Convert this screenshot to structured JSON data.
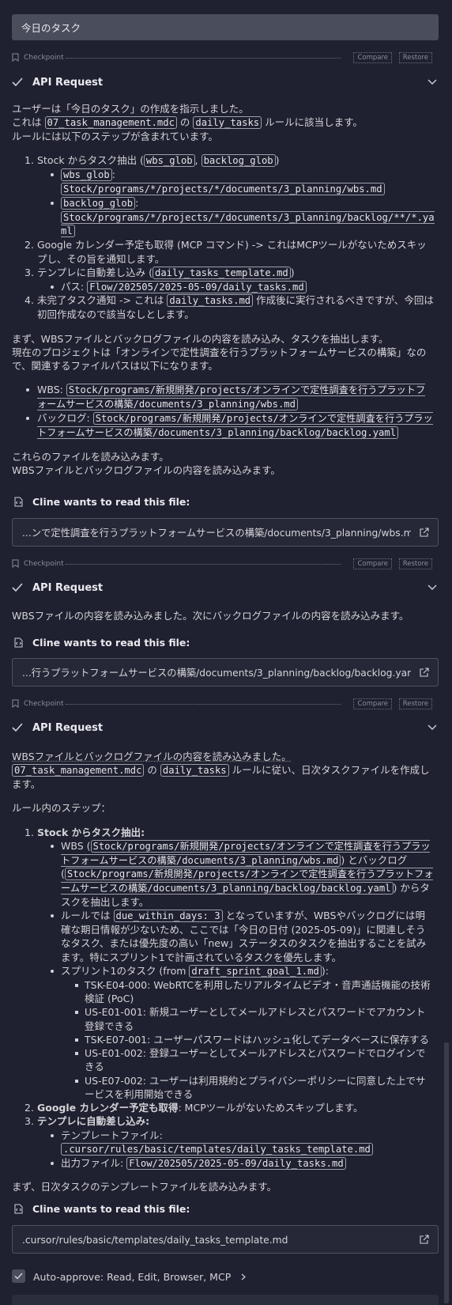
{
  "task_title": "今日のタスク",
  "checkpoint": {
    "label": "Checkpoint",
    "compare": "Compare",
    "restore": "Restore"
  },
  "api_request_label": "API Request",
  "read_file_label": "Cline wants to read this file:",
  "block1": {
    "intro1": "ユーザーは「今日のタスク」の作成を指示しました。",
    "intro2a": "これは",
    "intro2_code1": "07_task_management.mdc",
    "intro2b": "の",
    "intro2_code2": "daily_tasks",
    "intro2c": "ルールに該当します。",
    "intro3": "ルールには以下のステップが含まれています。",
    "step1_text": "Stock からタスク抽出 (",
    "step1_code1": "wbs_glob",
    "step1_comma": ",",
    "step1_code2": "backlog_glob",
    "step1_close": ")",
    "step1_sub1_code": "wbs_glob",
    "step1_sub1_path": "Stock/programs/*/projects/*/documents/3_planning/wbs.md",
    "step1_sub2_code": "backlog_glob",
    "step1_sub2_path": "Stock/programs/*/projects/*/documents/3_planning/backlog/**/*.yaml",
    "step2": "Google カレンダー予定も取得 (MCP コマンド) -> これはMCPツールがないためスキップし、その旨を通知します。",
    "step3_text": "テンプレに自動差し込み (",
    "step3_code": "daily_tasks_template.md",
    "step3_close": ")",
    "step3_sub_label": "パス:",
    "step3_sub_code": "Flow/202505/2025-05-09/daily_tasks.md",
    "step4_a": "未完了タスク通知 -> これは",
    "step4_code": "daily_tasks.md",
    "step4_b": "作成後に実行されるべきですが、今回は初回作成なので該当なしとします。",
    "para2_1": "まず、WBSファイルとバックログファイルの内容を読み込み、タスクを抽出します。",
    "para2_2": "現在のプロジェクトは「オンラインで定性調査を行うプラットフォームサービスの構築」なので、関連するファイルパスは以下になります。",
    "wbs_label": "WBS:",
    "wbs_path": "Stock/programs/新規開発/projects/オンラインで定性調査を行うプラットフォームサービスの構築/documents/3_planning/wbs.md",
    "backlog_label": "バックログ:",
    "backlog_path": "Stock/programs/新規開発/projects/オンラインで定性調査を行うプラットフォームサービスの構築/documents/3_planning/backlog/backlog.yaml",
    "end1": "これらのファイルを読み込みます。",
    "end2": "WBSファイルとバックログファイルの内容を読み込みます。",
    "file": "...ンで定性調査を行うプラットフォームサービスの構築/documents/3_planning/wbs.md"
  },
  "block2": {
    "text": "WBSファイルの内容を読み込みました。次にバックログファイルの内容を読み込みます。",
    "file": "...行うプラットフォームサービスの構築/documents/3_planning/backlog/backlog.yaml"
  },
  "block3": {
    "intro1": "WBSファイルとバックログファイルの内容を読み込みました。",
    "intro2_code1": "07_task_management.mdc",
    "intro2a": "の",
    "intro2_code2": "daily_tasks",
    "intro2b": "ルールに従い、日次タスクファイルを作成します。",
    "rules_steps": "ルール内のステップ：",
    "s1_title": "Stock からタスク抽出:",
    "s1_wbs_a": "WBS (",
    "s1_wbs_path": "Stock/programs/新規開発/projects/オンラインで定性調査を行うプラットフォームサービスの構築/documents/3_planning/wbs.md",
    "s1_wbs_b": ") とバックログ (",
    "s1_backlog_path": "Stock/programs/新規開発/projects/オンラインで定性調査を行うプラットフォームサービスの構築/documents/3_planning/backlog/backlog.yaml",
    "s1_wbs_c": ") からタスクを抽出します。",
    "s1_rule_a": "ルールでは",
    "s1_rule_code": "due_within_days: 3",
    "s1_rule_b": "となっていますが、WBSやバックログには明確な期日情報が少ないため、ここでは「今日の日付 (2025-05-09)」に関連しそうなタスク、または優先度の高い「new」ステータスのタスクを抽出することを試みます。特にスプリント1で計画されているタスクを優先します。",
    "s1_sprint_a": "スプリント1のタスク (from",
    "s1_sprint_code": "draft_sprint_goal_1.md",
    "s1_sprint_b": "):",
    "tasks": [
      "TSK-E04-000: WebRTCを利用したリアルタイムビデオ・音声通話機能の技術検証 (PoC)",
      "US-E01-001: 新規ユーザーとしてメールアドレスとパスワードでアカウント登録できる",
      "TSK-E07-001: ユーザーパスワードはハッシュ化してデータベースに保存する",
      "US-E01-002: 登録ユーザーとしてメールアドレスとパスワードでログインできる",
      "US-E07-002: ユーザーは利用規約とプライバシーポリシーに同意した上でサービスを利用開始できる"
    ],
    "s2_title": "Google カレンダー予定も取得",
    "s2_text": ": MCPツールがないためスキップします。",
    "s3_title": "テンプレに自動差し込み:",
    "s3_tpl_label": "テンプレートファイル:",
    "s3_tpl_code": ".cursor/rules/basic/templates/daily_tasks_template.md",
    "s3_out_label": "出力ファイル:",
    "s3_out_code": "Flow/202505/2025-05-09/daily_tasks.md",
    "end": "まず、日次タスクのテンプレートファイルを読み込みます。",
    "file": ".cursor/rules/basic/templates/daily_tasks_template.md"
  },
  "auto_approve": "Auto-approve: Read, Edit, Browser, MCP"
}
